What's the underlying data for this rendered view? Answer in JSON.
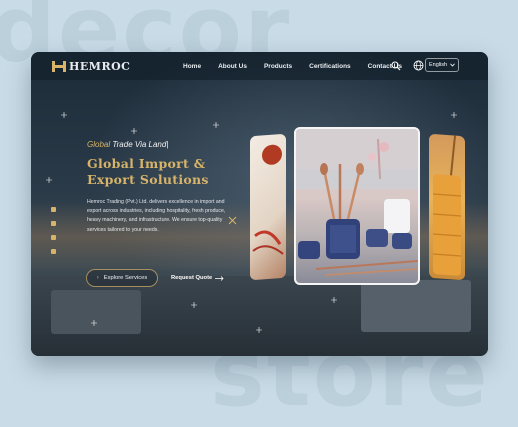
{
  "background": {
    "top_word": "decor",
    "bottom_word": "store"
  },
  "nav": {
    "logo_text": "HEMROC",
    "items": [
      {
        "label": "Home"
      },
      {
        "label": "About Us"
      },
      {
        "label": "Products"
      },
      {
        "label": "Certifications"
      },
      {
        "label": "Contact Us"
      }
    ],
    "search_icon": "search-icon",
    "language": {
      "selected": "English",
      "icon": "globe-icon"
    }
  },
  "hero": {
    "eyebrow_accent": "Global",
    "eyebrow_rest": " Trade Via Land|",
    "title": "Global Import & Export Solutions",
    "description": "Hemroc Trading (Pvt.) Ltd. delivers excellence in import and export across industries, including hospitality, fresh produce, heavy machinery, and infrastructure. We ensure top-quality services tailored to your needs.",
    "primary_button": "Explore Services",
    "secondary_button": "Request Quote"
  },
  "colors": {
    "accent": "#d8b46a",
    "nav_bg": "#14212c",
    "text": "#e9edf0"
  }
}
